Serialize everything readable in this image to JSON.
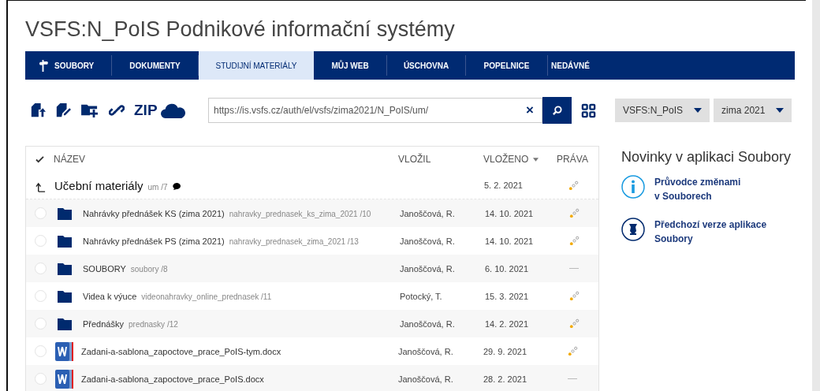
{
  "page_title": "VSFS:N_PoIS Podnikové informační systémy",
  "tabs": [
    {
      "label": "SOUBORY",
      "selected": false,
      "icon": true
    },
    {
      "label": "DOKUMENTY",
      "selected": false
    },
    {
      "label": "STUDIJNÍ MATERIÁLY",
      "selected": true
    },
    {
      "label": "MŮJ WEB",
      "selected": false
    },
    {
      "label": "ÚSCHOVNA",
      "selected": false
    },
    {
      "label": "POPELNICE",
      "selected": false
    },
    {
      "label": "NEDÁVNÉ",
      "selected": false
    }
  ],
  "toolbar": {
    "zip_label": "ZIP",
    "address": {
      "value": "https://is.vsfs.cz/auth/el/vsfs/zima2021/N_PoIS/um/",
      "clear": "×"
    },
    "dropdowns": [
      "VSFS:N_PoIS",
      "zima 2021"
    ]
  },
  "table": {
    "columns": [
      "NÁZEV",
      "VLOŽIL",
      "VLOŽENO",
      "PRÁVA"
    ],
    "parent": {
      "name": "Učební materiály",
      "path": "um /7",
      "date": "5. 2. 2021",
      "shared": true
    },
    "rows": [
      {
        "kind": "folder",
        "name": "Nahrávky přednášek KS (zima 2021)",
        "path": "nahravky_prednasek_ks_zima_2021 /10",
        "author": "Janoščová, R.",
        "date": "14. 10. 2021",
        "shared": true,
        "selected": false
      },
      {
        "kind": "folder",
        "name": "Nahrávky přednášek PS (zima 2021)",
        "path": "nahravky_prednasek_zima_2021 /13",
        "author": "Janoščová, R.",
        "date": "14. 10. 2021",
        "shared": true,
        "selected": false
      },
      {
        "kind": "folder",
        "name": "SOUBORY",
        "path": "soubory /8",
        "author": "Janoščová, R.",
        "date": "6. 10. 2021",
        "shared": false,
        "selected": false
      },
      {
        "kind": "folder",
        "name": "Videa k výuce",
        "path": "videonahravky_online_prednasek /11",
        "author": "Potocký, T.",
        "date": "15. 3. 2021",
        "shared": true,
        "selected": false
      },
      {
        "kind": "folder",
        "name": "Přednášky",
        "path": "prednasky /12",
        "author": "Janoščová, R.",
        "date": "14. 2. 2021",
        "shared": true,
        "selected": false
      },
      {
        "kind": "word",
        "name": "Zadani-a-sablona_zapoctove_prace_PoIS-tym.docx",
        "author": "Janoščová, R.",
        "date": "29. 9. 2021",
        "shared": true,
        "selected": false
      },
      {
        "kind": "word",
        "name": "Zadani-a-sablona_zapoctove_prace_PoIS.docx",
        "author": "Janoščová, R.",
        "date": "28. 2. 2021",
        "shared": false,
        "selected": false
      }
    ]
  },
  "news": {
    "title": "Novinky v aplikaci Soubory",
    "links": [
      {
        "kind": "info",
        "lines": [
          "Průvodce změnami",
          "v Souborech"
        ]
      },
      {
        "kind": "vase",
        "lines": [
          "Předchozí verze aplikace",
          "Soubory"
        ]
      }
    ]
  }
}
